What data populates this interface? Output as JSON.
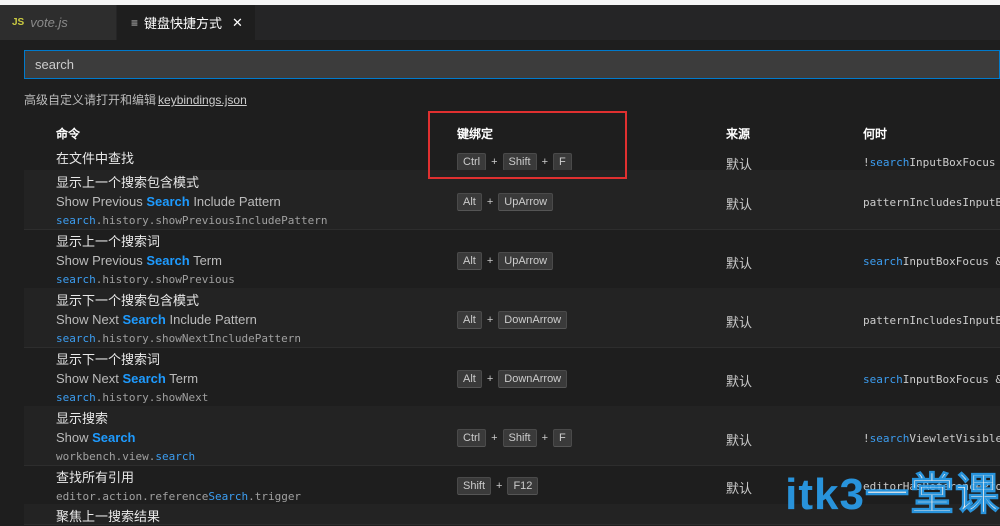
{
  "tabs": [
    {
      "icon": "JS",
      "label": "vote.js"
    },
    {
      "icon": "≡",
      "label": "键盘快捷方式",
      "close": "✕"
    }
  ],
  "search": {
    "value": "search"
  },
  "hint": {
    "text": "高级自定义请打开和编辑",
    "link": "keybindings.json"
  },
  "headers": {
    "command": "命令",
    "keybinding": "键绑定",
    "source": "来源",
    "when": "何时"
  },
  "rows": [
    {
      "title": "在文件中查找",
      "keys": [
        "Ctrl",
        "Shift",
        "F"
      ],
      "source": "默认",
      "when_hl": "",
      "when_pre": "!",
      "when_hl2": "search",
      "when_rest": "InputBoxFocus"
    },
    {
      "title": "显示上一个搜索包含模式",
      "en_pre": "Show Previous ",
      "en_hl": "Search",
      "en_post": " Include Pattern",
      "id_pre": "",
      "id_hl": "search",
      "id_post": ".history.showPreviousIncludePattern",
      "keys": [
        "Alt",
        "UpArrow"
      ],
      "source": "默认",
      "when_pre": "patternIncludesInputBo",
      "when_hl2": "",
      "when_rest": ""
    },
    {
      "title": "显示上一个搜索词",
      "en_pre": "Show Previous ",
      "en_hl": "Search",
      "en_post": " Term",
      "id_pre": "",
      "id_hl": "search",
      "id_post": ".history.showPrevious",
      "keys": [
        "Alt",
        "UpArrow"
      ],
      "source": "默认",
      "when_pre": "",
      "when_hl2": "search",
      "when_rest": "InputBoxFocus &&"
    },
    {
      "title": "显示下一个搜索包含模式",
      "en_pre": "Show Next ",
      "en_hl": "Search",
      "en_post": " Include Pattern",
      "id_pre": "",
      "id_hl": "search",
      "id_post": ".history.showNextIncludePattern",
      "keys": [
        "Alt",
        "DownArrow"
      ],
      "source": "默认",
      "when_pre": "patternIncludesInputBo",
      "when_hl2": "",
      "when_rest": ""
    },
    {
      "title": "显示下一个搜索词",
      "en_pre": "Show Next ",
      "en_hl": "Search",
      "en_post": " Term",
      "id_pre": "",
      "id_hl": "search",
      "id_post": ".history.showNext",
      "keys": [
        "Alt",
        "DownArrow"
      ],
      "source": "默认",
      "when_pre": "",
      "when_hl2": "search",
      "when_rest": "InputBoxFocus &&"
    },
    {
      "title": "显示搜索",
      "en_pre": "Show ",
      "en_hl": "Search",
      "en_post": "",
      "id_pre": "workbench.view.",
      "id_hl": "search",
      "id_post": "",
      "keys": [
        "Ctrl",
        "Shift",
        "F"
      ],
      "source": "默认",
      "when_pre": "!",
      "when_hl2": "search",
      "when_rest": "ViewletVisible"
    },
    {
      "title": "查找所有引用",
      "id_pre": "editor.action.reference",
      "id_hl": "Search",
      "id_post": ".trigger",
      "keys": [
        "Shift",
        "F12"
      ],
      "source": "默认",
      "when_pre": "editorHasReferenceProv",
      "when_hl2": "",
      "when_rest": ""
    },
    {
      "title": "聚焦上一搜索结果"
    }
  ],
  "watermark": {
    "main": "itk3",
    "cn": "一堂课"
  }
}
